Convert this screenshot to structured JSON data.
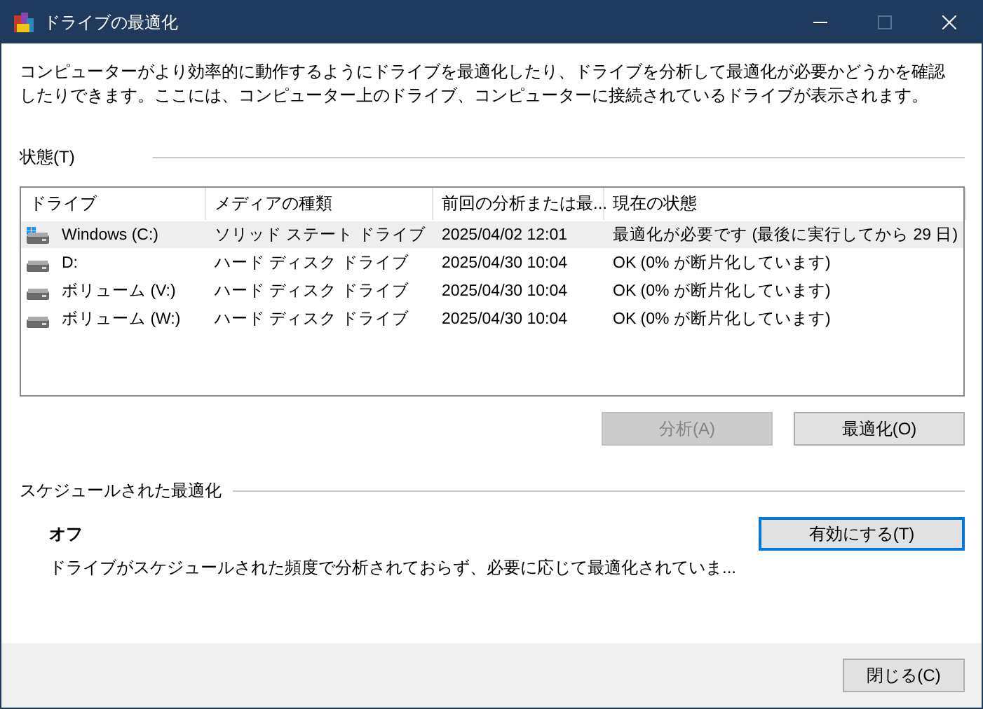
{
  "window": {
    "title": "ドライブの最適化",
    "controls": [
      {
        "kind": "minimize",
        "disabled": false
      },
      {
        "kind": "maximize",
        "disabled": true
      },
      {
        "kind": "close",
        "disabled": false
      }
    ]
  },
  "description": "コンピューターがより効率的に動作するようにドライブを最適化したり、ドライブを分析して最適化が必要かどうかを確認したりできます。ここには、コンピューター上のドライブ、コンピューターに接続されているドライブが表示されます。",
  "status_section": {
    "label": "状態(T)"
  },
  "table": {
    "columns": [
      "ドライブ",
      "メディアの種類",
      "前回の分析または最...",
      "現在の状態"
    ],
    "rows": [
      {
        "kind": "system",
        "drive": "Windows (C:)",
        "media": "ソリッド ステート ドライブ",
        "last": "2025/04/02 12:01",
        "status": "最適化が必要です (最後に実行してから 29 日)",
        "selected": true
      },
      {
        "kind": "hdd",
        "drive": "D:",
        "media": "ハード ディスク ドライブ",
        "last": "2025/04/30 10:04",
        "status": "OK (0% が断片化しています)",
        "selected": false
      },
      {
        "kind": "hdd",
        "drive": "ボリューム (V:)",
        "media": "ハード ディスク ドライブ",
        "last": "2025/04/30 10:04",
        "status": "OK (0% が断片化しています)",
        "selected": false
      },
      {
        "kind": "hdd",
        "drive": "ボリューム (W:)",
        "media": "ハード ディスク ドライブ",
        "last": "2025/04/30 10:04",
        "status": "OK (0% が断片化しています)",
        "selected": false
      }
    ]
  },
  "actions": [
    {
      "label": "分析(A)",
      "disabled": true
    },
    {
      "label": "最適化(O)",
      "disabled": false
    }
  ],
  "schedule": {
    "label": "スケジュールされた最適化",
    "state": "オフ",
    "detail": "ドライブがスケジュールされた頻度で分析されておらず、必要に応じて最適化されていま...",
    "button": {
      "label": "有効にする(T)",
      "focused": true
    }
  },
  "footer": {
    "button": "閉じる(C)"
  }
}
